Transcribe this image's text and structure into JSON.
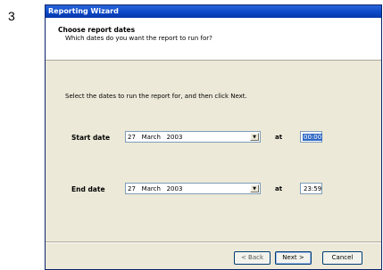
{
  "step_number": "3",
  "window": {
    "title": "Reporting Wizard"
  },
  "header": {
    "title": "Choose report dates",
    "subtitle": "Which dates do you want the report to run for?"
  },
  "instruction": "Select the dates to run the report for, and then click Next.",
  "start": {
    "label": "Start date",
    "date_value": "27   March   2003",
    "at_label": "at",
    "time_value": "00:00"
  },
  "end": {
    "label": "End date",
    "date_value": "27   March   2003",
    "at_label": "at",
    "time_value": "23:59"
  },
  "buttons": {
    "back": "< Back",
    "next": "Next >",
    "cancel": "Cancel"
  }
}
